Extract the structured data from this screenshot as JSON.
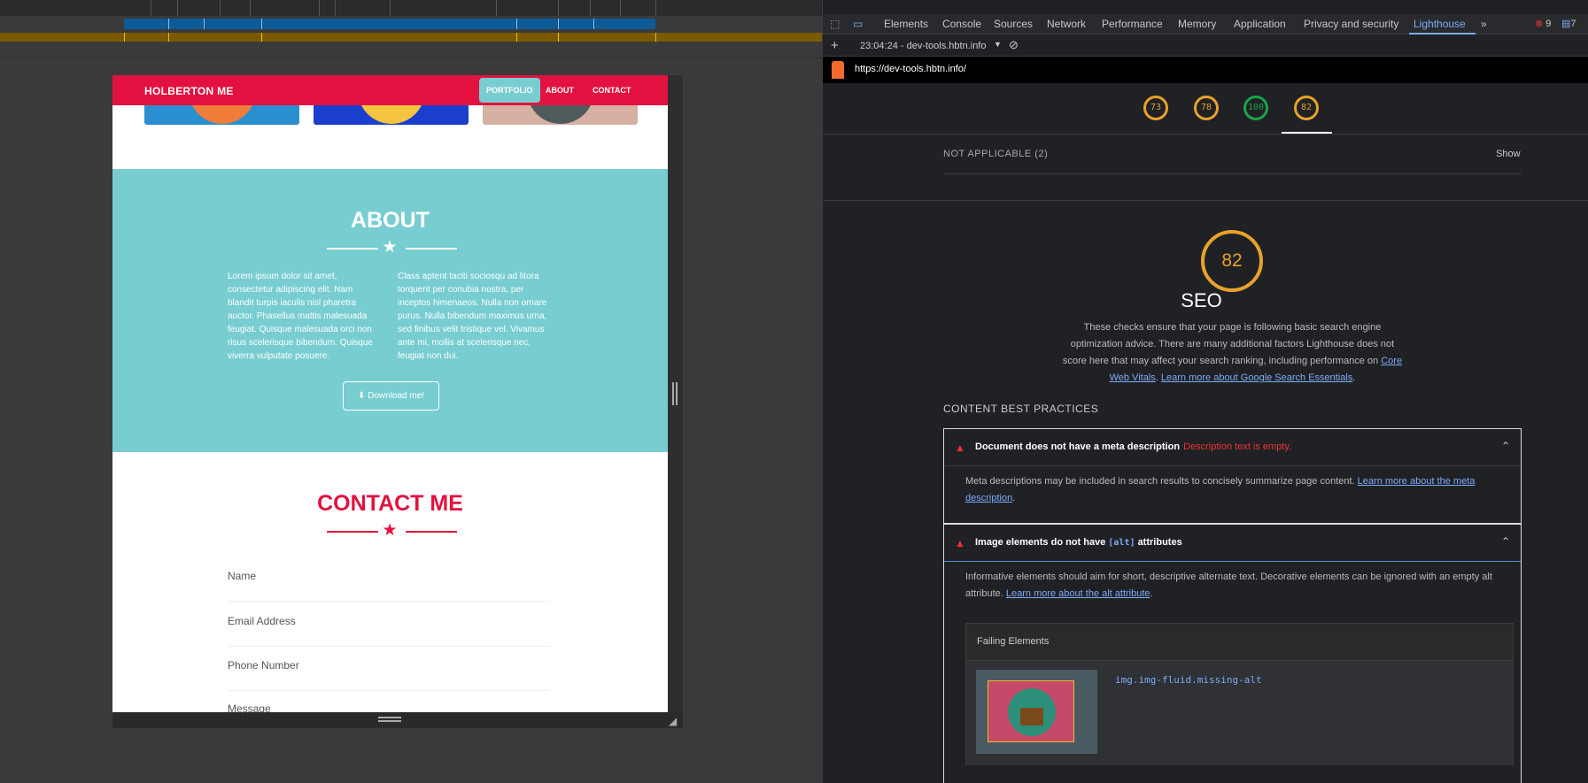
{
  "devtools": {
    "tabs": [
      "Elements",
      "Console",
      "Sources",
      "Network",
      "Performance",
      "Memory",
      "Application",
      "Privacy and security",
      "Lighthouse"
    ],
    "more_tabs": "»",
    "errors_count": "9",
    "messages_count": "7",
    "session": "23:04:24 - dev-tools.hbtn.info",
    "url": "https://dev-tools.hbtn.info/",
    "scores": [
      "73",
      "78",
      "100",
      "82"
    ],
    "not_applicable": "NOT APPLICABLE (2)",
    "show": "Show",
    "seo": {
      "score": "82",
      "title": "SEO",
      "description": "These checks ensure that your page is following basic search engine optimization advice. There are many additional factors Lighthouse does not score here that may affect your search ranking, including performance on",
      "link1": "Core Web Vitals",
      "sep": ". ",
      "link2": "Learn more about Google Search Essentials",
      "end": "."
    },
    "content_best_practices": "CONTENT BEST PRACTICES",
    "audit1": {
      "title": "Document does not have a meta description",
      "error": "Description text is empty.",
      "desc": "Meta descriptions may be included in search results to concisely summarize page content.",
      "link": "Learn more about the meta description",
      "end": "."
    },
    "audit2": {
      "title_pre": "Image elements do not have",
      "title_code": "[alt]",
      "title_post": "attributes",
      "desc": "Informative elements should aim for short, descriptive alternate text. Decorative elements can be ignored with an empty alt attribute.",
      "link": "Learn more about the alt attribute",
      "end": ".",
      "failing_header": "Failing Elements",
      "failing_selector": "img.img-fluid.missing-alt"
    }
  },
  "site": {
    "brand": "HOLBERTON ME",
    "nav": [
      "PORTFOLIO",
      "ABOUT",
      "CONTACT"
    ],
    "about_title": "ABOUT",
    "about_col1": "Lorem ipsum dolor sit amet, consectetur adipiscing elit. Nam blandit turpis iaculis nisl pharetra auctor. Phasellus mattis malesuada feugiat. Quisque malesuada orci non risus scelerisque bibendum. Quisque viverra vulputate posuere.",
    "about_col2": "Class aptent taciti sociosqu ad litora torquent per conubia nostra, per inceptos himenaeos. Nulla non ornare purus. Nulla bibendum maximus urna, sed finibus velit tristique vel. Vivamus ante mi, mollis at scelerisque nec, feugiat non dui.",
    "download": "Download me!",
    "contact_title": "CONTACT ME",
    "fields": [
      "Name",
      "Email Address",
      "Phone Number",
      "Message"
    ]
  },
  "colors": {
    "brand_red": "#e3113f",
    "teal": "#78cdd1",
    "score_orange": "#e8a22b",
    "score_green": "#1aa34a",
    "link_blue": "#7cacf8"
  }
}
